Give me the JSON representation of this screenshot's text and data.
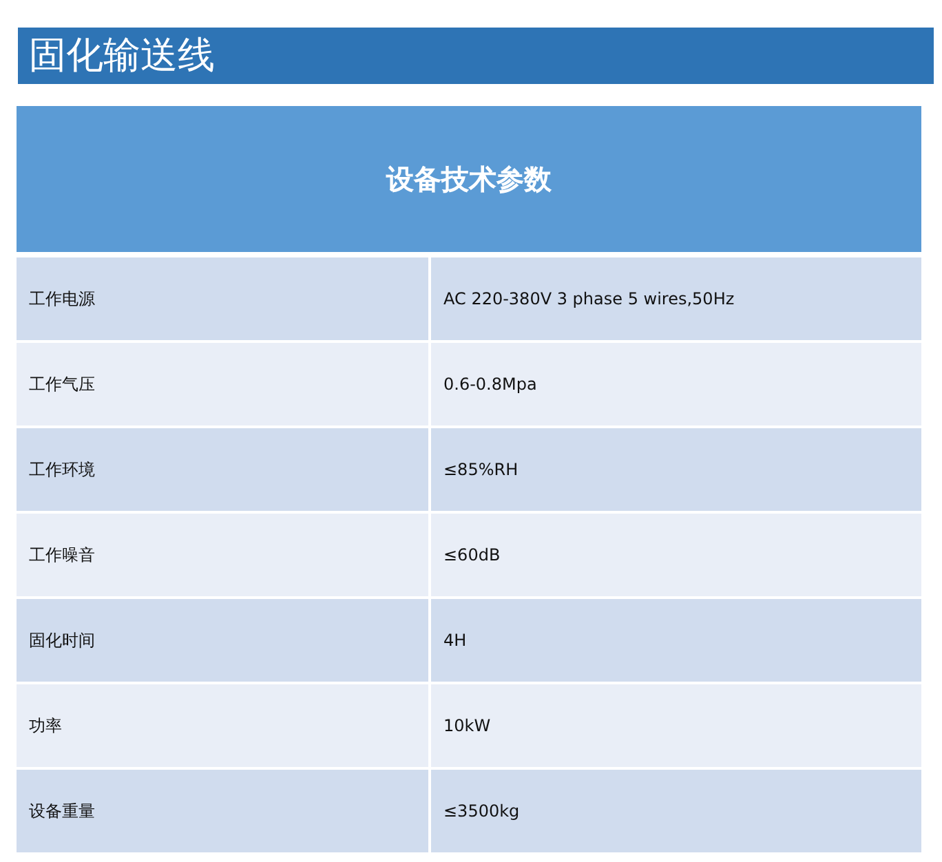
{
  "title": "固化输送线",
  "table": {
    "header": "设备技术参数",
    "rows": [
      {
        "label": "工作电源",
        "value": "AC 220-380V 3 phase 5 wires,50Hz"
      },
      {
        "label": "工作气压",
        "value": "0.6-0.8Mpa"
      },
      {
        "label": "工作环境",
        "value": "≤85%RH"
      },
      {
        "label": "工作噪音",
        "value": "≤60dB"
      },
      {
        "label": "固化时间",
        "value": "4H"
      },
      {
        "label": "功率",
        "value": "10kW"
      },
      {
        "label": "设备重量",
        "value": "≤3500kg"
      }
    ]
  }
}
